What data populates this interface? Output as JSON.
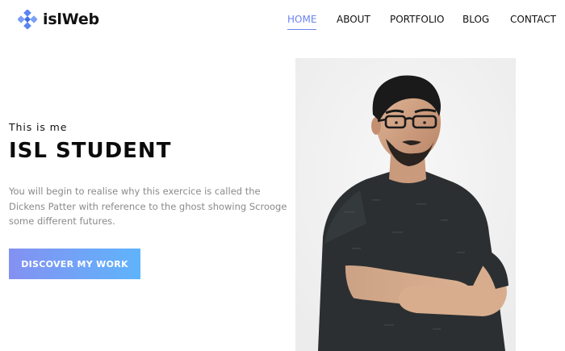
{
  "brand": {
    "name": "islWeb",
    "accent_color": "#6b83f0",
    "logo_color": "#5b86f2",
    "logo_icon": "diamond-cluster-icon"
  },
  "nav": {
    "items": [
      {
        "label": "HOME",
        "active": true
      },
      {
        "label": "ABOUT",
        "active": false
      },
      {
        "label": "PORTFOLIO",
        "active": false
      },
      {
        "label": "BLOG",
        "active": false
      },
      {
        "label": "CONTACT",
        "active": false
      }
    ]
  },
  "hero": {
    "eyebrow": "This is me",
    "title": "ISL STUDENT",
    "description": "You will begin to realise why this exercice is called the Dickens Patter with reference to the ghost showing Scrooge some different futures.",
    "cta_label": "DISCOVER MY WORK",
    "cta_gradient": [
      "#8491f2",
      "#5fb4fb"
    ]
  },
  "portrait": {
    "subject": "man with glasses and beard, arms crossed, dark t-shirt",
    "background_color": "#f1f1f1"
  }
}
